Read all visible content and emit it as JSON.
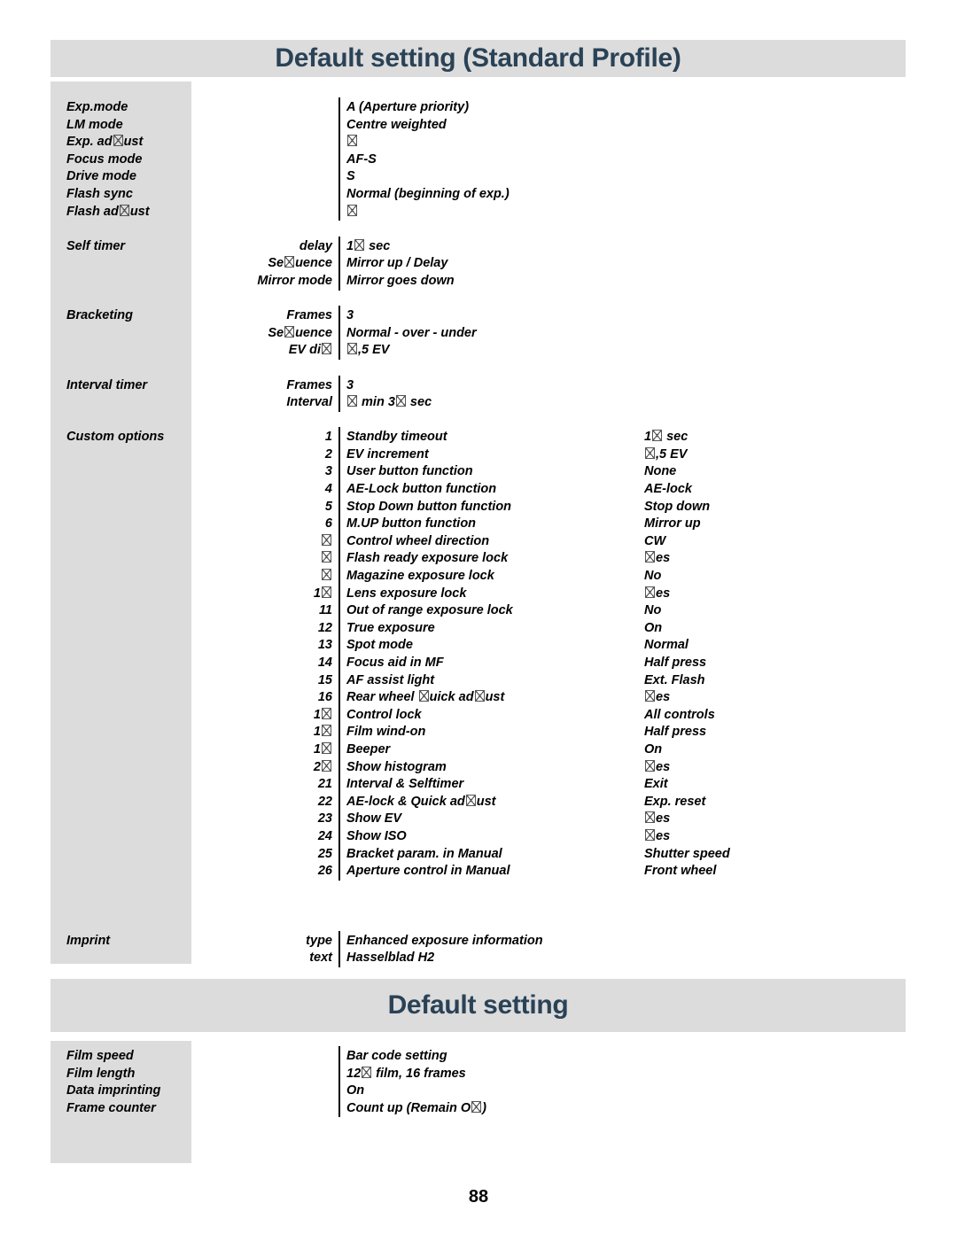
{
  "page": {
    "number": "88",
    "missing_glyph": "▯",
    "accent_color": "#2a4256",
    "panel_color": "#dcdcdc"
  },
  "section1": {
    "title": "Default setting (Standard Profile)",
    "rows": [
      {
        "label": "Exp.mode",
        "sub": "",
        "index": "",
        "value": "A (Aperture priority)",
        "value2": ""
      },
      {
        "label": "LM mode",
        "sub": "",
        "index": "",
        "value": "Centre weighted",
        "value2": ""
      },
      {
        "label": "Exp. ad▯ust",
        "sub": "",
        "index": "",
        "value": "▯",
        "value2": ""
      },
      {
        "label": "Focus mode",
        "sub": "",
        "index": "",
        "value": "AF-S",
        "value2": ""
      },
      {
        "label": "Drive mode",
        "sub": "",
        "index": "",
        "value": "S",
        "value2": ""
      },
      {
        "label": "Flash sync",
        "sub": "",
        "index": "",
        "value": "Normal (beginning of exp.)",
        "value2": ""
      },
      {
        "label": "Flash ad▯ust",
        "sub": "",
        "index": "",
        "value": "▯",
        "value2": ""
      },
      {
        "label": "",
        "sub": "",
        "index": "",
        "value": "",
        "value2": ""
      },
      {
        "label": "Self timer",
        "sub": "delay",
        "index": "",
        "value": "1▯ sec",
        "value2": ""
      },
      {
        "label": "",
        "sub": "Se▯uence",
        "index": "",
        "value": " Mirror up / Delay",
        "value2": ""
      },
      {
        "label": "",
        "sub": "Mirror mode",
        "index": "",
        "value": "Mirror goes down",
        "value2": ""
      },
      {
        "label": "",
        "sub": "",
        "index": "",
        "value": "",
        "value2": ""
      },
      {
        "label": "Bracketing",
        "sub": "Frames",
        "index": "",
        "value": "3",
        "value2": ""
      },
      {
        "label": "",
        "sub": "Se▯uence",
        "index": "",
        "value": " Normal - over - under",
        "value2": ""
      },
      {
        "label": "",
        "sub": "EV di▯",
        "index": "",
        "value": " ▯,5 EV",
        "value2": ""
      },
      {
        "label": "",
        "sub": "",
        "index": "",
        "value": "",
        "value2": ""
      },
      {
        "label": "Interval timer",
        "sub": "Frames",
        "index": "",
        "value": "3",
        "value2": ""
      },
      {
        "label": "",
        "sub": "Interval",
        "index": "",
        "value": "▯ min 3▯ sec",
        "value2": ""
      },
      {
        "label": "",
        "sub": "",
        "index": "",
        "value": "",
        "value2": ""
      },
      {
        "label": "Custom options",
        "sub": "",
        "index": "1",
        "value": "Standby timeout",
        "value2": "1▯ sec"
      },
      {
        "label": "",
        "sub": "",
        "index": "2",
        "value": "EV increment",
        "value2": "▯,5 EV"
      },
      {
        "label": "",
        "sub": "",
        "index": "3",
        "value": "User button function",
        "value2": "None"
      },
      {
        "label": "",
        "sub": "",
        "index": "4",
        "value": "AE-Lock button function",
        "value2": "AE-lock"
      },
      {
        "label": "",
        "sub": "",
        "index": "5",
        "value": "Stop Down button function",
        "value2": "Stop down"
      },
      {
        "label": "",
        "sub": "",
        "index": "6",
        "value": "M.UP button function",
        "value2": "Mirror up"
      },
      {
        "label": "",
        "sub": "",
        "index": "▯",
        "value": " Control wheel direction",
        "value2": "CW"
      },
      {
        "label": "",
        "sub": "",
        "index": "▯",
        "value": " Flash ready exposure lock",
        "value2": "▯es"
      },
      {
        "label": "",
        "sub": "",
        "index": "▯",
        "value": " Magazine exposure lock",
        "value2": "No"
      },
      {
        "label": "",
        "sub": "",
        "index": "1▯",
        "value": " Lens exposure lock",
        "value2": "▯es"
      },
      {
        "label": "",
        "sub": "",
        "index": "11",
        "value": "Out of range exposure lock",
        "value2": "No"
      },
      {
        "label": "",
        "sub": "",
        "index": "12",
        "value": "True exposure",
        "value2": "On"
      },
      {
        "label": "",
        "sub": "",
        "index": "13",
        "value": "Spot mode",
        "value2": "Normal"
      },
      {
        "label": "",
        "sub": "",
        "index": "14",
        "value": "Focus aid in MF",
        "value2": "Half press"
      },
      {
        "label": "",
        "sub": "",
        "index": "15",
        "value": "AF assist light",
        "value2": "Ext. Flash"
      },
      {
        "label": "",
        "sub": "",
        "index": "16",
        "value": "Rear wheel ▯uick ad▯ust",
        "value2": "▯es"
      },
      {
        "label": "",
        "sub": "",
        "index": "1▯",
        "value": " Control lock",
        "value2": "All controls"
      },
      {
        "label": "",
        "sub": "",
        "index": "1▯",
        "value": " Film wind-on",
        "value2": "Half press"
      },
      {
        "label": "",
        "sub": "",
        "index": "1▯",
        "value": " Beeper",
        "value2": "On"
      },
      {
        "label": "",
        "sub": "",
        "index": "2▯",
        "value": " Show histogram",
        "value2": "▯es"
      },
      {
        "label": "",
        "sub": "",
        "index": "21",
        "value": "Interval & Selftimer",
        "value2": "Exit"
      },
      {
        "label": "",
        "sub": "",
        "index": "22",
        "value": "AE-lock & Quick ad▯ust",
        "value2": "Exp. reset"
      },
      {
        "label": "",
        "sub": "",
        "index": "23",
        "value": "Show EV",
        "value2": "▯es"
      },
      {
        "label": "",
        "sub": "",
        "index": "24",
        "value": "Show ISO",
        "value2": "▯es"
      },
      {
        "label": "",
        "sub": "",
        "index": "25",
        "value": "Bracket param. in Manual",
        "value2": "Shutter speed"
      },
      {
        "label": "",
        "sub": "",
        "index": "26",
        "value": "Aperture control in Manual",
        "value2": "Front wheel"
      },
      {
        "label": "",
        "sub": "",
        "index": "",
        "value": "",
        "value2": ""
      },
      {
        "label": "",
        "sub": "",
        "index": "",
        "value": "",
        "value2": ""
      },
      {
        "label": "",
        "sub": "",
        "index": "",
        "value": "",
        "value2": ""
      },
      {
        "label": "Imprint",
        "sub": "type",
        "index": "",
        "value": "Enhanced exposure information",
        "value2": ""
      },
      {
        "label": "",
        "sub": "text",
        "index": "",
        "value": "Hasselblad H2",
        "value2": ""
      }
    ]
  },
  "section2": {
    "title": "Default setting",
    "rows": [
      {
        "label": "Film speed",
        "sub": "",
        "index": "",
        "value": "Bar code setting",
        "value2": ""
      },
      {
        "label": "Film length",
        "sub": "",
        "index": "",
        "value": "12▯ film, 16 frames",
        "value2": ""
      },
      {
        "label": "Data imprinting",
        "sub": "",
        "index": "",
        "value": "On",
        "value2": ""
      },
      {
        "label": "Frame counter",
        "sub": "",
        "index": "",
        "value": "Count up (Remain O▯)",
        "value2": ""
      }
    ]
  }
}
